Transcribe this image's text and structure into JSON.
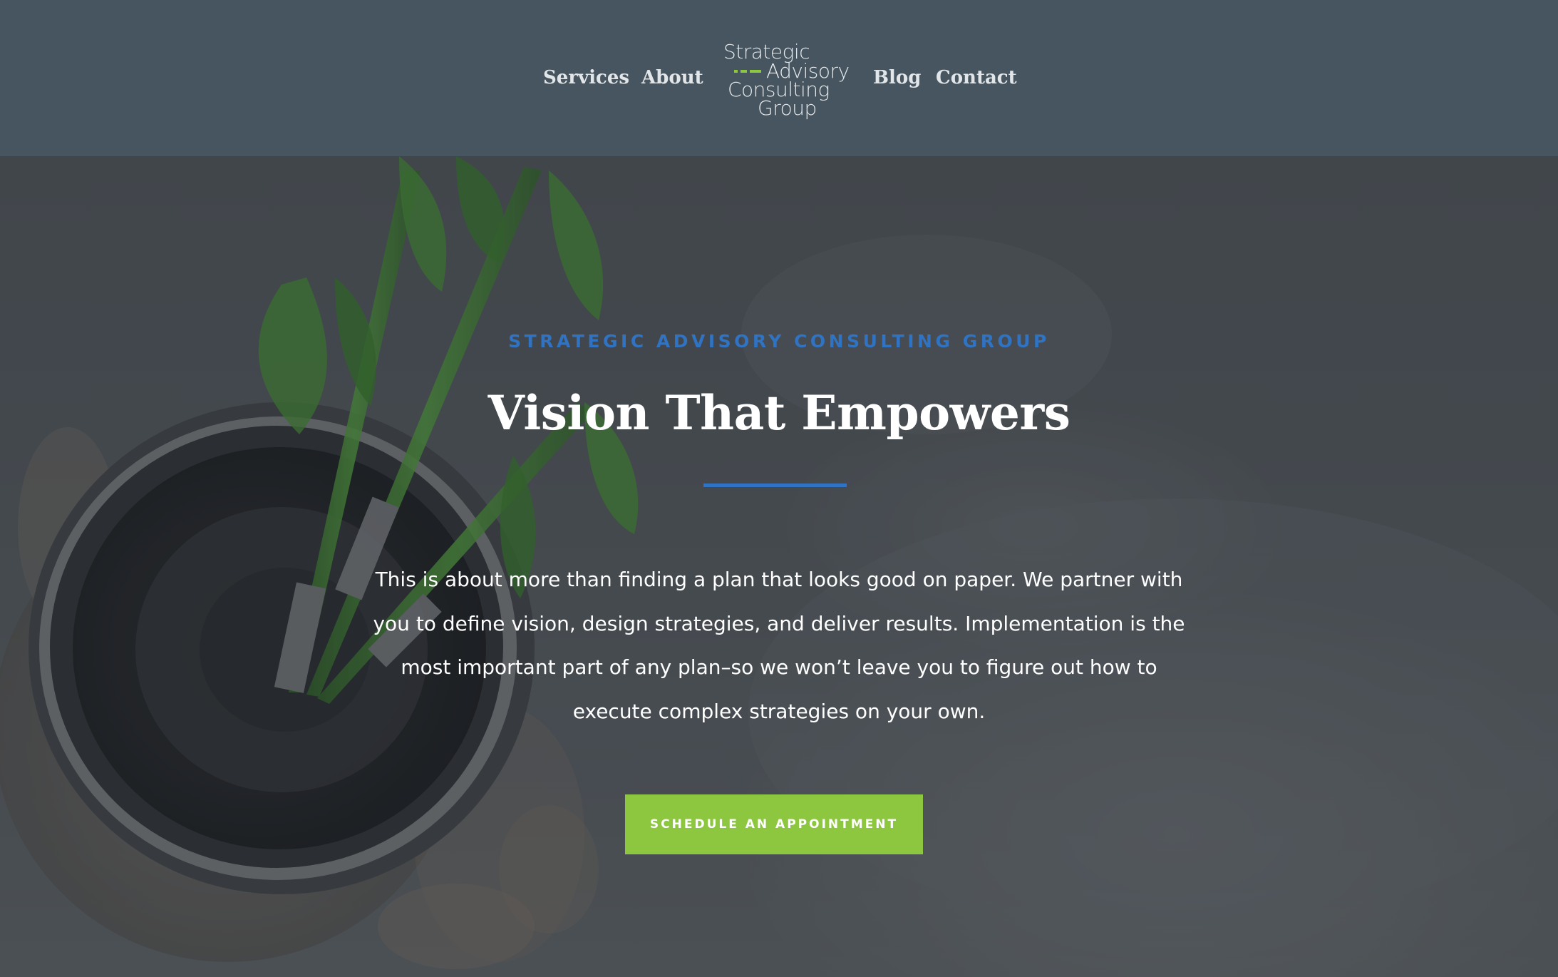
{
  "header": {
    "nav_left": [
      "Services",
      "About"
    ],
    "nav_right": [
      "Blog",
      "Contact"
    ],
    "logo": {
      "line1": "Strategic",
      "line2": "Advisory",
      "line3": "Consulting",
      "line4": "Group",
      "accent_color": "#8dc63f"
    }
  },
  "hero": {
    "eyebrow": "STRATEGIC ADVISORY CONSULTING GROUP",
    "title": "Vision That Empowers",
    "body": "This is about more than finding a plan that looks good on paper. We partner with you to define vision, design strategies, and deliver results. Implementation is the most important part of any plan–so we won’t leave you to figure out how to execute complex strategies on your own.",
    "cta_label": "SCHEDULE AN APPOINTMENT"
  },
  "colors": {
    "header_bg": "#46555f",
    "accent_blue": "#2f73c2",
    "accent_green": "#8dc63f",
    "text_light": "#ffffff"
  }
}
